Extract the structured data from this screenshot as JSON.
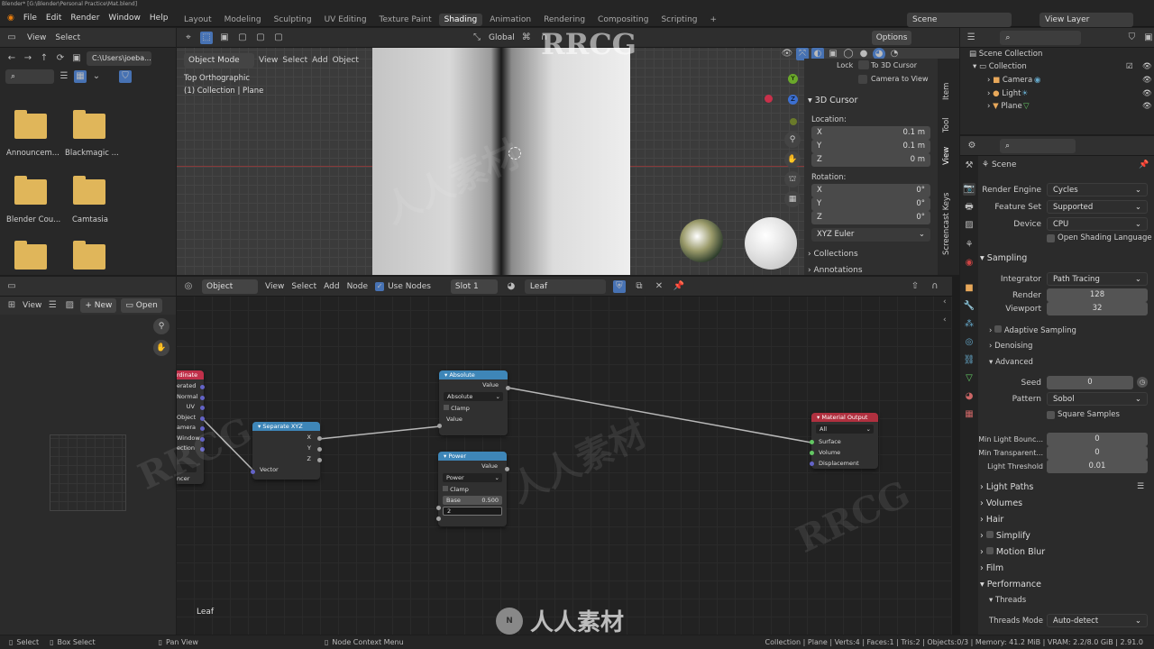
{
  "title": "Blender* [G:\\Blender\\Personal Practice\\Mat.blend]",
  "menu": [
    "File",
    "Edit",
    "Render",
    "Window",
    "Help"
  ],
  "workspaces": [
    "Layout",
    "Modeling",
    "Sculpting",
    "UV Editing",
    "Texture Paint",
    "Shading",
    "Animation",
    "Rendering",
    "Compositing",
    "Scripting"
  ],
  "active_workspace": "Shading",
  "scene": "Scene",
  "view_layer": "View Layer",
  "filebrowser": {
    "view": "View",
    "select": "Select",
    "path": "C:\\Users\\joeba...",
    "folders": [
      "Announcem...",
      "Blackmagic ...",
      "Blender Cou...",
      "Camtasia"
    ]
  },
  "viewport": {
    "mode": "Object Mode",
    "menus": [
      "View",
      "Select",
      "Add",
      "Object"
    ],
    "transform": "Global",
    "options": "Options",
    "info1": "Top Orthographic",
    "info2": "(1) Collection | Plane"
  },
  "npanel": {
    "lock": "Lock",
    "to_cursor": "To 3D Cursor",
    "cam_to_view": "Camera to View",
    "cursor_title": "3D Cursor",
    "location": "Location:",
    "x": "0.1 m",
    "y": "0.1 m",
    "z": "0 m",
    "rotation": "Rotation:",
    "rx": "0°",
    "ry": "0°",
    "rz": "0°",
    "euler": "XYZ Euler",
    "collections": "Collections",
    "annotations": "Annotations",
    "tabs": [
      "Item",
      "Tool",
      "View",
      "Screencast Keys"
    ]
  },
  "outliner": {
    "scene_collection": "Scene Collection",
    "items": [
      "Collection",
      "Camera",
      "Light",
      "Plane"
    ]
  },
  "props": {
    "scene": "Scene",
    "render_engine_l": "Render Engine",
    "render_engine": "Cycles",
    "feature_set_l": "Feature Set",
    "feature_set": "Supported",
    "device_l": "Device",
    "device": "CPU",
    "osl": "Open Shading Language",
    "sampling": "Sampling",
    "integrator_l": "Integrator",
    "integrator": "Path Tracing",
    "render_l": "Render",
    "render": "128",
    "viewport_l": "Viewport",
    "viewport": "32",
    "adaptive": "Adaptive Sampling",
    "denoising": "Denoising",
    "advanced": "Advanced",
    "seed_l": "Seed",
    "seed": "0",
    "pattern_l": "Pattern",
    "pattern": "Sobol",
    "square": "Square Samples",
    "min_bounce_l": "Min Light Bounc...",
    "min_bounce": "0",
    "min_trans_l": "Min Transparent...",
    "min_trans": "0",
    "threshold_l": "Light Threshold",
    "threshold": "0.01",
    "light_paths": "Light Paths",
    "volumes": "Volumes",
    "hair": "Hair",
    "simplify": "Simplify",
    "motion_blur": "Motion Blur",
    "film": "Film",
    "performance": "Performance",
    "threads": "Threads",
    "threads_mode_l": "Threads Mode",
    "threads_mode": "Auto-detect"
  },
  "image_editor": {
    "view": "View",
    "new": "New",
    "open": "Open"
  },
  "node_editor": {
    "object": "Object",
    "menus": [
      "View",
      "Select",
      "Add",
      "Node"
    ],
    "use_nodes": "Use Nodes",
    "slot": "Slot 1",
    "material": "Leaf",
    "label": "Leaf"
  },
  "nodes": {
    "texcoord": {
      "title": "rdinate",
      "outs": [
        "erated",
        "Normal",
        "UV",
        "Object",
        "amera",
        "Window",
        "ection"
      ],
      "extra": "ncer"
    },
    "separate": {
      "title": "Separate XYZ",
      "outs": [
        "X",
        "Y",
        "Z"
      ],
      "in": "Vector"
    },
    "absolute": {
      "title": "Absolute",
      "out": "Value",
      "op": "Absolute",
      "clamp": "Clamp",
      "in": "Value"
    },
    "power": {
      "title": "Power",
      "out": "Value",
      "op": "Power",
      "clamp": "Clamp",
      "base_l": "Base",
      "base": "0.500",
      "exp": "2"
    },
    "output": {
      "title": "Material Output",
      "target": "All",
      "ins": [
        "Surface",
        "Volume",
        "Displacement"
      ]
    }
  },
  "statusbar": {
    "select": "Select",
    "box_select": "Box Select",
    "pan": "Pan View",
    "ctx": "Node Context Menu",
    "stats": "Collection | Plane | Verts:4 | Faces:1 | Tris:2 | Objects:0/3 | Memory: 41.2 MiB | VRAM: 2.2/8.0 GiB | 2.91.0"
  },
  "watermarks": [
    "RRCG",
    "人人素材"
  ],
  "colors": {
    "accent": "#4772b3",
    "texcoord_hdr": "#c0304a",
    "converter_hdr": "#3e86b8",
    "output_hdr": "#b0303f"
  }
}
